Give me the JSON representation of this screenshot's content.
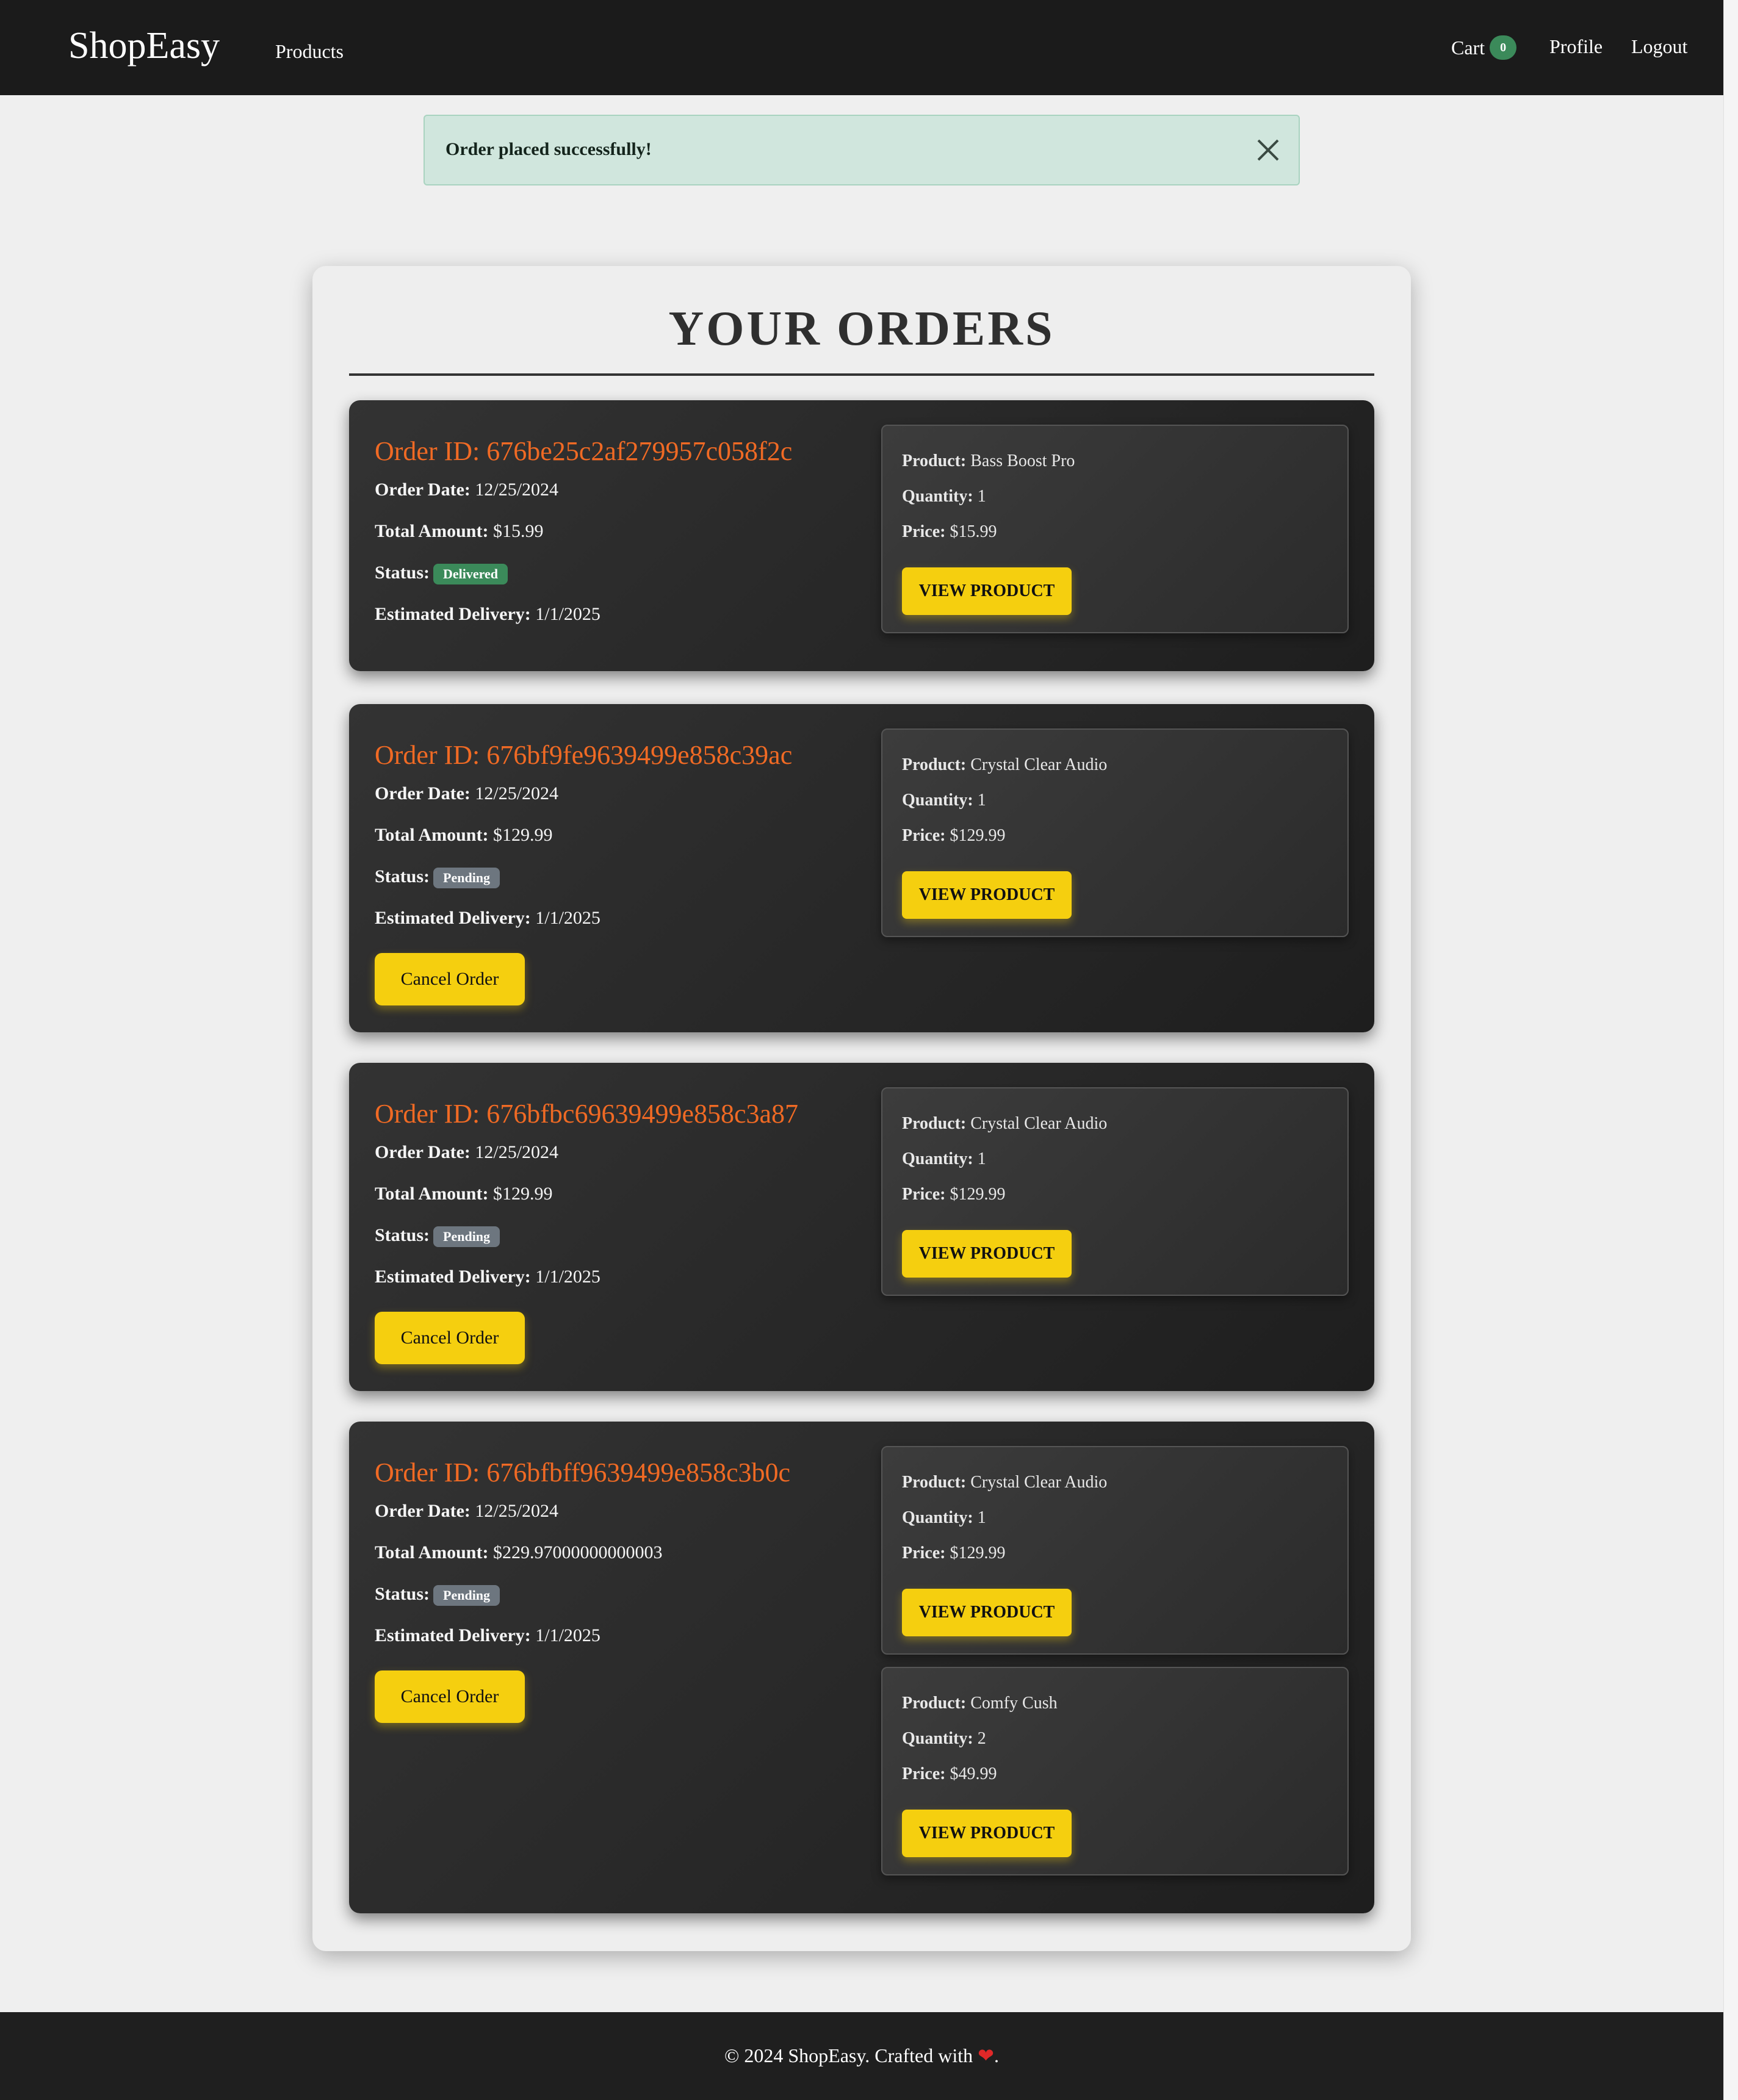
{
  "nav": {
    "brand": "ShopEasy",
    "products": "Products",
    "cart": "Cart",
    "cart_count": "0",
    "profile": "Profile",
    "logout": "Logout"
  },
  "alert": {
    "message": "Order placed successfully!"
  },
  "orders_title": "YOUR ORDERS",
  "labels": {
    "order_id": "Order ID: ",
    "order_date": "Order Date:",
    "total_amount": "Total Amount:",
    "status": "Status:",
    "estimated_delivery": "Estimated Delivery:",
    "product": "Product:",
    "quantity": "Quantity:",
    "price": "Price:",
    "view_product": "VIEW PRODUCT",
    "cancel_order": "Cancel Order"
  },
  "orders": [
    {
      "id": "676be25c2af279957c058f2c",
      "date": "12/25/2024",
      "total": "$15.99",
      "status": "Delivered",
      "delivery": "1/1/2025",
      "items": [
        {
          "product": "Bass Boost Pro",
          "quantity": "1",
          "price": "$15.99"
        }
      ]
    },
    {
      "id": "676bf9fe9639499e858c39ac",
      "date": "12/25/2024",
      "total": "$129.99",
      "status": "Pending",
      "delivery": "1/1/2025",
      "items": [
        {
          "product": "Crystal Clear Audio",
          "quantity": "1",
          "price": "$129.99"
        }
      ]
    },
    {
      "id": "676bfbc69639499e858c3a87",
      "date": "12/25/2024",
      "total": "$129.99",
      "status": "Pending",
      "delivery": "1/1/2025",
      "items": [
        {
          "product": "Crystal Clear Audio",
          "quantity": "1",
          "price": "$129.99"
        }
      ]
    },
    {
      "id": "676bfbff9639499e858c3b0c",
      "date": "12/25/2024",
      "total": "$229.97000000000003",
      "status": "Pending",
      "delivery": "1/1/2025",
      "items": [
        {
          "product": "Crystal Clear Audio",
          "quantity": "1",
          "price": "$129.99"
        },
        {
          "product": "Comfy Cush",
          "quantity": "2",
          "price": "$49.99"
        }
      ]
    }
  ],
  "footer": {
    "text": "© 2024 ShopEasy. Crafted with",
    "heart": "❤",
    "end": "."
  },
  "colors": {
    "accent_orange": "#f06a24",
    "button_yellow": "#f5cf0f",
    "delivered_green": "#3b8a5a",
    "pending_gray": "#6d767f"
  }
}
